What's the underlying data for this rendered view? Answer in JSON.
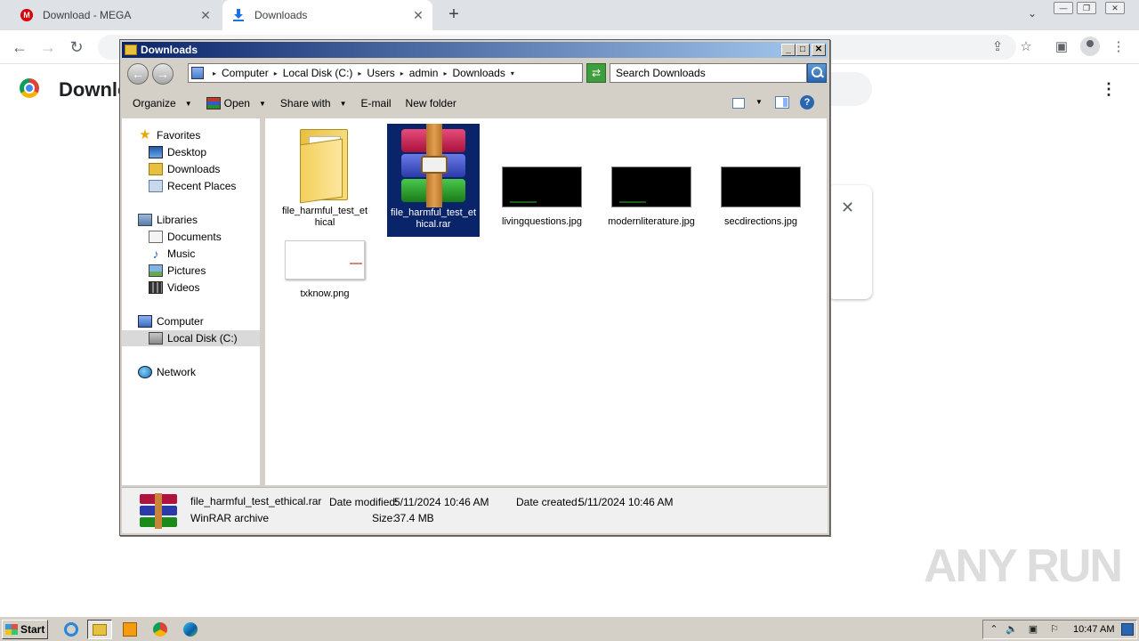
{
  "browser": {
    "tabs": [
      {
        "label": "Download - MEGA",
        "icon": "mega-icon",
        "active": false
      },
      {
        "label": "Downloads",
        "icon": "download-icon",
        "active": true
      }
    ],
    "page_title": "Downloads",
    "page_title_visible": "Downlo"
  },
  "explorer": {
    "title": "Downloads",
    "breadcrumb": [
      "Computer",
      "Local Disk (C:)",
      "Users",
      "admin",
      "Downloads"
    ],
    "search_placeholder": "Search Downloads",
    "commands": [
      {
        "label": "Organize",
        "dropdown": true
      },
      {
        "label": "Open",
        "dropdown": true
      },
      {
        "label": "Share with",
        "dropdown": true
      },
      {
        "label": "E-mail",
        "dropdown": false
      },
      {
        "label": "New folder",
        "dropdown": false
      }
    ],
    "nav": {
      "favorites": "Favorites",
      "favorites_items": [
        "Desktop",
        "Downloads",
        "Recent Places"
      ],
      "libraries": "Libraries",
      "libraries_items": [
        "Documents",
        "Music",
        "Pictures",
        "Videos"
      ],
      "computer": "Computer",
      "computer_items": [
        "Local Disk (C:)"
      ],
      "network": "Network"
    },
    "files": [
      {
        "name": "file_harmful_test_ethical",
        "type": "folder",
        "selected": false
      },
      {
        "name": "file_harmful_test_ethical.rar",
        "type": "rar",
        "selected": true
      },
      {
        "name": "livingquestions.jpg",
        "type": "jpg-black",
        "selected": false
      },
      {
        "name": "modernliterature.jpg",
        "type": "jpg-black",
        "selected": false
      },
      {
        "name": "secdirections.jpg",
        "type": "jpg-black",
        "selected": false
      },
      {
        "name": "txknow.png",
        "type": "png-white",
        "selected": false
      }
    ],
    "details": {
      "filename": "file_harmful_test_ethical.rar",
      "filetype": "WinRAR archive",
      "date_modified_label": "Date modified:",
      "date_modified": "5/11/2024 10:46 AM",
      "date_created_label": "Date created:",
      "date_created": "5/11/2024 10:46 AM",
      "size_label": "Size:",
      "size": "37.4 MB"
    }
  },
  "taskbar": {
    "start_label": "Start",
    "clock": "10:47 AM"
  },
  "watermark": "ANY RUN"
}
